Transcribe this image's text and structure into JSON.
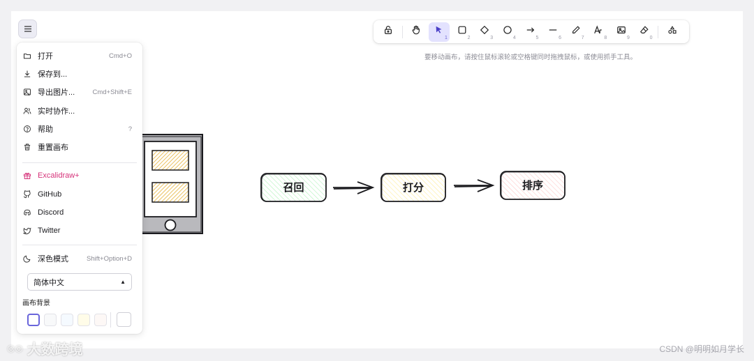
{
  "colors": {
    "accent": "#6965db",
    "brand": "#d6337a",
    "active_tool_bg": "#e3e2fe"
  },
  "menu_toggle": {
    "icon": "hamburger-icon"
  },
  "toolbar": {
    "tools": [
      {
        "name": "lock",
        "icon": "lock-icon",
        "key": ""
      },
      {
        "name": "hand",
        "icon": "hand-icon",
        "key": ""
      },
      {
        "name": "selection",
        "icon": "pointer-icon",
        "key": "1",
        "active": true
      },
      {
        "name": "rectangle",
        "icon": "square-icon",
        "key": "2"
      },
      {
        "name": "diamond",
        "icon": "diamond-icon",
        "key": "3"
      },
      {
        "name": "ellipse",
        "icon": "circle-icon",
        "key": "4"
      },
      {
        "name": "arrow",
        "icon": "arrow-icon",
        "key": "5"
      },
      {
        "name": "line",
        "icon": "line-icon",
        "key": "6"
      },
      {
        "name": "draw",
        "icon": "pencil-icon",
        "key": "7"
      },
      {
        "name": "text",
        "icon": "text-icon",
        "key": "8"
      },
      {
        "name": "image",
        "icon": "image-icon",
        "key": "9"
      },
      {
        "name": "eraser",
        "icon": "eraser-icon",
        "key": "0"
      },
      {
        "name": "library",
        "icon": "shapes-icon",
        "key": ""
      }
    ]
  },
  "hint": "要移动画布，请按住鼠标滚轮或空格键同时拖拽鼠标，或使用抓手工具。",
  "menu": {
    "items": [
      {
        "label": "打开",
        "shortcut": "Cmd+O",
        "icon": "folder-icon"
      },
      {
        "label": "保存到...",
        "shortcut": "",
        "icon": "download-icon"
      },
      {
        "label": "导出图片...",
        "shortcut": "Cmd+Shift+E",
        "icon": "export-image-icon"
      },
      {
        "label": "实时协作...",
        "shortcut": "",
        "icon": "users-icon"
      },
      {
        "label": "帮助",
        "shortcut": "?",
        "icon": "help-icon"
      },
      {
        "label": "重置画布",
        "shortcut": "",
        "icon": "trash-icon"
      }
    ],
    "links": [
      {
        "label": "Excalidraw+",
        "icon": "gift-icon"
      },
      {
        "label": "GitHub",
        "icon": "github-icon"
      },
      {
        "label": "Discord",
        "icon": "discord-icon"
      },
      {
        "label": "Twitter",
        "icon": "twitter-icon"
      }
    ],
    "dark_mode": {
      "label": "深色模式",
      "shortcut": "Shift+Option+D",
      "icon": "moon-icon"
    },
    "language": {
      "selected": "简体中文"
    },
    "canvas_bg": {
      "label": "画布背景",
      "swatches": [
        "#ffffff",
        "#f8f9fa",
        "#f5faff",
        "#fffce8",
        "#fdf8f6"
      ],
      "selected": 0,
      "custom": "#ffffff"
    }
  },
  "diagram": {
    "boxes": [
      {
        "label": "召回",
        "fill": "#b2f2bb"
      },
      {
        "label": "打分",
        "fill": "#ffec99"
      },
      {
        "label": "排序",
        "fill": "#ffc9c9"
      }
    ]
  },
  "watermarks": {
    "left": "大数跨境",
    "right": "CSDN @明明如月学长"
  }
}
